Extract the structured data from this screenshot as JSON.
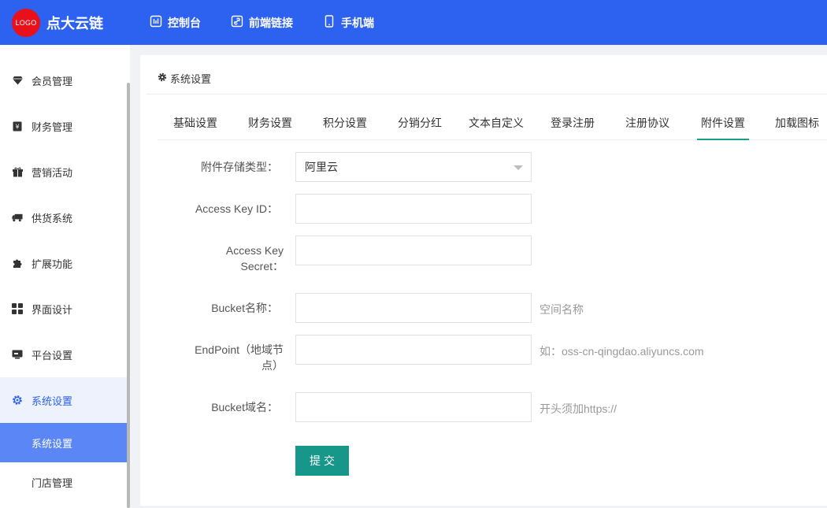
{
  "header": {
    "logo_text": "LOGO",
    "brand": "点大云链",
    "nav": [
      {
        "label": "控制台",
        "icon": "dashboard-icon"
      },
      {
        "label": "前端链接",
        "icon": "link-icon"
      },
      {
        "label": "手机端",
        "icon": "mobile-icon"
      }
    ]
  },
  "sidebar": {
    "items": [
      {
        "label": "会员管理",
        "icon": "diamond-icon"
      },
      {
        "label": "财务管理",
        "icon": "finance-icon"
      },
      {
        "label": "营销活动",
        "icon": "gift-icon"
      },
      {
        "label": "供货系统",
        "icon": "truck-icon"
      },
      {
        "label": "扩展功能",
        "icon": "puzzle-icon"
      },
      {
        "label": "界面设计",
        "icon": "layout-icon"
      },
      {
        "label": "平台设置",
        "icon": "monitor-icon"
      },
      {
        "label": "系统设置",
        "icon": "gear-icon"
      }
    ],
    "subitems": [
      {
        "label": "系统设置"
      },
      {
        "label": "门店管理"
      }
    ]
  },
  "card": {
    "title": "系统设置",
    "tabs": [
      {
        "label": "基础设置"
      },
      {
        "label": "财务设置"
      },
      {
        "label": "积分设置"
      },
      {
        "label": "分销分红"
      },
      {
        "label": "文本自定义"
      },
      {
        "label": "登录注册"
      },
      {
        "label": "注册协议"
      },
      {
        "label": "附件设置"
      },
      {
        "label": "加载图标"
      }
    ],
    "active_tab": "附件设置"
  },
  "form": {
    "storage_type_label": "附件存储类型：",
    "storage_type_value": "阿里云",
    "access_key_id_label": "Access Key ID：",
    "access_key_id_value": "",
    "access_key_secret_label_1": "Access Key",
    "access_key_secret_label_2": "Secret：",
    "access_key_secret_value": "",
    "bucket_name_label": "Bucket名称：",
    "bucket_name_value": "",
    "bucket_name_hint": "空间名称",
    "endpoint_label_1": "EndPoint（地域节",
    "endpoint_label_2": "点）",
    "endpoint_value": "",
    "endpoint_hint": "如：oss-cn-qingdao.aliyuncs.com",
    "bucket_domain_label": "Bucket域名：",
    "bucket_domain_value": "",
    "bucket_domain_hint": "开头须加https://",
    "submit_label": "提交"
  },
  "colors": {
    "header_bg": "#2d61f0",
    "logo_bg": "#e8101a",
    "active_submenu_bg": "#5b86f6",
    "active_tab_underline": "#17a085",
    "submit_bg": "#17978a"
  }
}
